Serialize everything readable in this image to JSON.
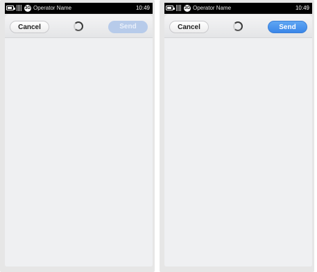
{
  "screens": [
    {
      "status": {
        "network_badge": "3G",
        "operator": "Operator Name",
        "time": "10:49"
      },
      "toolbar": {
        "cancel_label": "Cancel",
        "send_label": "Send",
        "send_state": "disabled"
      }
    },
    {
      "status": {
        "network_badge": "3G",
        "operator": "Operator Name",
        "time": "10:49"
      },
      "toolbar": {
        "cancel_label": "Cancel",
        "send_label": "Send",
        "send_state": "enabled"
      }
    }
  ],
  "colors": {
    "send_enabled": "#4a95ee",
    "send_disabled": "#b7cbea",
    "content_bg": "#eff0f2",
    "statusbar_bg": "#000000"
  },
  "icons": [
    "battery-icon",
    "signal-icon",
    "network-badge-icon",
    "loading-spinner-icon"
  ]
}
